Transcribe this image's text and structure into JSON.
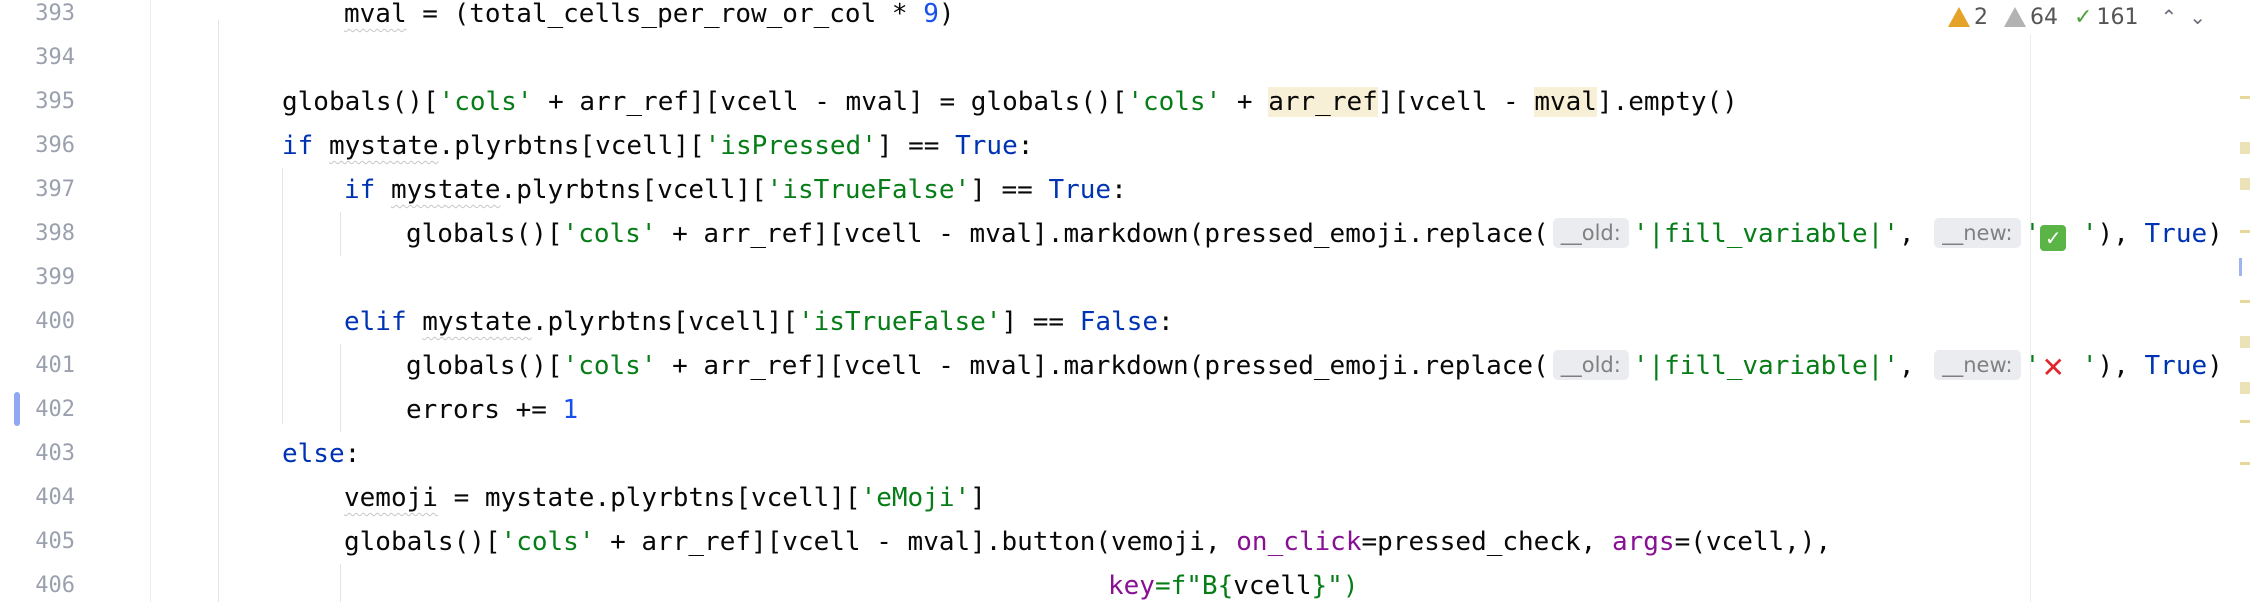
{
  "editor": {
    "line_numbers": [
      "393",
      "394",
      "395",
      "396",
      "397",
      "398",
      "399",
      "400",
      "401",
      "402",
      "403",
      "404",
      "405",
      "406"
    ],
    "lines": {
      "l393": {
        "a": "mval",
        "b": " = (total_cells_per_row_or_col * ",
        "c": "9",
        "d": ")"
      },
      "l395": {
        "a": "globals",
        "b": "()[",
        "c": "'cols'",
        "d": " + arr_ref][vcell - mval] = ",
        "e": "globals",
        "f": "()[",
        "g": "'cols'",
        "h": " + ",
        "i": "arr_ref",
        "j": "][vcell - ",
        "k": "mval",
        "l": "].empty()"
      },
      "l396": {
        "a": "if",
        "b": " ",
        "c": "mystate",
        "d": ".plyrbtns[vcell][",
        "e": "'isPressed'",
        "f": "] == ",
        "g": "True",
        "h": ":"
      },
      "l397": {
        "a": "if",
        "b": " ",
        "c": "mystate",
        "d": ".plyrbtns[vcell][",
        "e": "'isTrueFalse'",
        "f": "] == ",
        "g": "True",
        "h": ":"
      },
      "l398": {
        "a": "globals",
        "b": "()[",
        "c": "'cols'",
        "d": " + arr_ref][vcell - mval].markdown(pressed_emoji.replace(",
        "hint1": "__old:",
        "e": "'|fill_variable|'",
        "f": ", ",
        "hint2": "__new:",
        "g": "'",
        "emoji": "✓",
        "h": " '",
        "i": "), ",
        "j": "True",
        ")": ")"
      },
      "l400": {
        "a": "elif",
        "b": " ",
        "c": "mystate",
        "d": ".plyrbtns[vcell][",
        "e": "'isTrueFalse'",
        "f": "] == ",
        "g": "False",
        "h": ":"
      },
      "l401": {
        "a": "globals",
        "b": "()[",
        "c": "'cols'",
        "d": " + arr_ref][vcell - mval].markdown(pressed_emoji.replace(",
        "hint1": "__old:",
        "e": "'|fill_variable|'",
        "f": ", ",
        "hint2": "__new:",
        "g": "'",
        "emoji": "✕",
        "h": " '",
        "i": "), ",
        "j": "True",
        ")": ")"
      },
      "l402": {
        "a": "errors += ",
        "b": "1"
      },
      "l403": {
        "a": "else",
        ":": ":"
      },
      "l404": {
        "a": "vemoji",
        "b": " = mystate.plyrbtns[vcell][",
        "c": "'eMoji'",
        "d": "]"
      },
      "l405": {
        "a": "globals",
        "b": "()[",
        "c": "'cols'",
        "d": " + arr_ref][vcell - mval].button(vemoji, ",
        "e": "on_click",
        "f": "=pressed_check, ",
        "g": "args",
        "h": "=(vcell,),"
      },
      "l406": {
        "a": "key",
        "b": "=f\"B{",
        "c": "vcell",
        "d": "}\")"
      }
    }
  },
  "inspections": {
    "errors_count": "2",
    "warnings_count": "64",
    "typos_count": "161",
    "prev_icon": "chevron-up-icon",
    "next_icon": "chevron-down-icon"
  },
  "colors": {
    "keyword": "#0033b3",
    "string": "#067d17",
    "number": "#1750eb",
    "named_arg": "#871094",
    "highlight": "#f7efd6"
  }
}
